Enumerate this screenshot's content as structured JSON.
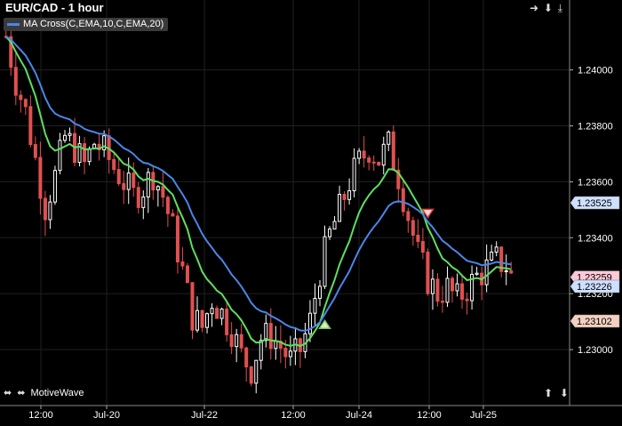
{
  "title": "EUR/CAD - 1 hour",
  "legend": {
    "label": "MA Cross(C,EMA,10,C,EMA,20)",
    "color_fast": "#5ee05e",
    "color_slow": "#4a86e8"
  },
  "brand": "MotiveWave",
  "controls": {
    "top": [
      "arrow-right-icon",
      "arrow-down-icon",
      "arrow-down-bar-icon"
    ],
    "bottom": [
      "arrow-up-icon",
      "arrow-down-icon"
    ],
    "bottom_left": [
      "arrow-left-icon",
      "arrow-right-icon"
    ]
  },
  "colors": {
    "background": "#000000",
    "up_candle": "#ffffff",
    "down_candle": "#e05050",
    "grid": "#202020",
    "axis_text": "#ffffff"
  },
  "price_labels": [
    {
      "value": "1.23525",
      "bg": "#cde0ff",
      "fg": "#000000"
    },
    {
      "value": "1.23259",
      "bg": "#ffc8d8",
      "fg": "#000000"
    },
    {
      "value": "1.23226",
      "bg": "#cde0ff",
      "fg": "#000000"
    },
    {
      "value": "1.23102",
      "bg": "#f4d0c0",
      "fg": "#000000"
    }
  ],
  "chart_data": {
    "type": "candlestick",
    "title": "EUR/CAD - 1 hour",
    "ylim": [
      1.228,
      1.2425
    ],
    "y_ticks": [
      "1.23000",
      "1.23200",
      "1.23400",
      "1.23600",
      "1.23800",
      "1.24000"
    ],
    "x_ticks": [
      "12:00",
      "Jul-20",
      "Jul-22",
      "12:00",
      "Jul-24",
      "12:00",
      "Jul-25"
    ],
    "grid": true,
    "legend_position": "top-left",
    "series": [
      {
        "name": "MA Cross(C,EMA,10,C,EMA,20)",
        "kind": "ema",
        "period": 10
      },
      {
        "name": "MA Cross(C,EMA,10,C,EMA,20)",
        "kind": "ema",
        "period": 20
      }
    ],
    "cross_signals": [
      {
        "direction": "up",
        "near": "12:00"
      },
      {
        "direction": "down",
        "near": "Jul-24"
      },
      {
        "direction": "up",
        "near": "12:00"
      },
      {
        "direction": "down",
        "near": "Jul-25"
      }
    ],
    "close_path": [
      1.2412,
      1.2396,
      1.2385,
      1.2368,
      1.2351,
      1.2362,
      1.2376,
      1.2372,
      1.2366,
      1.2374,
      1.2371,
      1.2365,
      1.236,
      1.2355,
      1.2358,
      1.2363,
      1.2355,
      1.2343,
      1.2328,
      1.2312,
      1.2308,
      1.2318,
      1.2313,
      1.2307,
      1.2298,
      1.2293,
      1.2304,
      1.2305,
      1.2301,
      1.2296,
      1.23,
      1.231,
      1.2328,
      1.2341,
      1.235,
      1.236,
      1.2367,
      1.2372,
      1.2368,
      1.2373,
      1.2362,
      1.2348,
      1.2334,
      1.2325,
      1.232,
      1.2322,
      1.2318,
      1.2322,
      1.2326,
      1.2329,
      1.2332,
      1.233,
      1.2322
    ]
  }
}
